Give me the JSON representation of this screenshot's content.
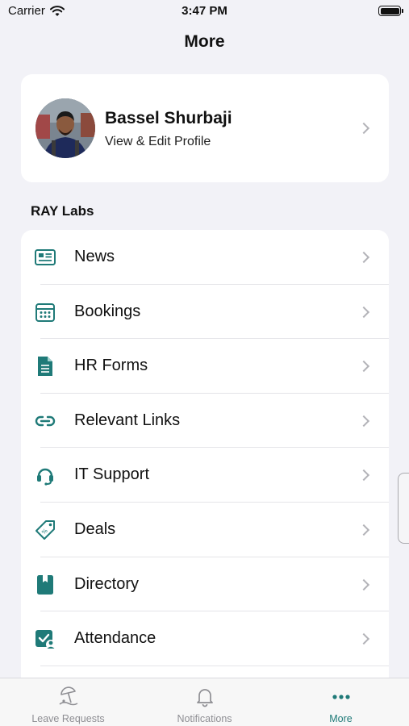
{
  "status_bar": {
    "carrier": "Carrier",
    "time": "3:47 PM"
  },
  "nav": {
    "title": "More"
  },
  "profile": {
    "name": "Bassel Shurbaji",
    "subtitle": "View & Edit Profile"
  },
  "section": {
    "title": "RAY Labs"
  },
  "menu": {
    "items": [
      {
        "label": "News",
        "icon": "newspaper-icon"
      },
      {
        "label": "Bookings",
        "icon": "calendar-icon"
      },
      {
        "label": "HR Forms",
        "icon": "document-icon"
      },
      {
        "label": "Relevant Links",
        "icon": "link-icon"
      },
      {
        "label": "IT Support",
        "icon": "headset-icon"
      },
      {
        "label": "Deals",
        "icon": "tag-icon"
      },
      {
        "label": "Directory",
        "icon": "book-icon"
      },
      {
        "label": "Attendance",
        "icon": "attendance-check-icon"
      }
    ]
  },
  "tab_bar": {
    "tabs": [
      {
        "label": "Leave Requests",
        "icon": "beach-umbrella-icon"
      },
      {
        "label": "Notifications",
        "icon": "bell-icon"
      },
      {
        "label": "More",
        "icon": "more-dots-icon",
        "active": true
      }
    ]
  },
  "colors": {
    "accent": "#1f7a78",
    "background": "#f2f2f7",
    "card": "#ffffff"
  }
}
